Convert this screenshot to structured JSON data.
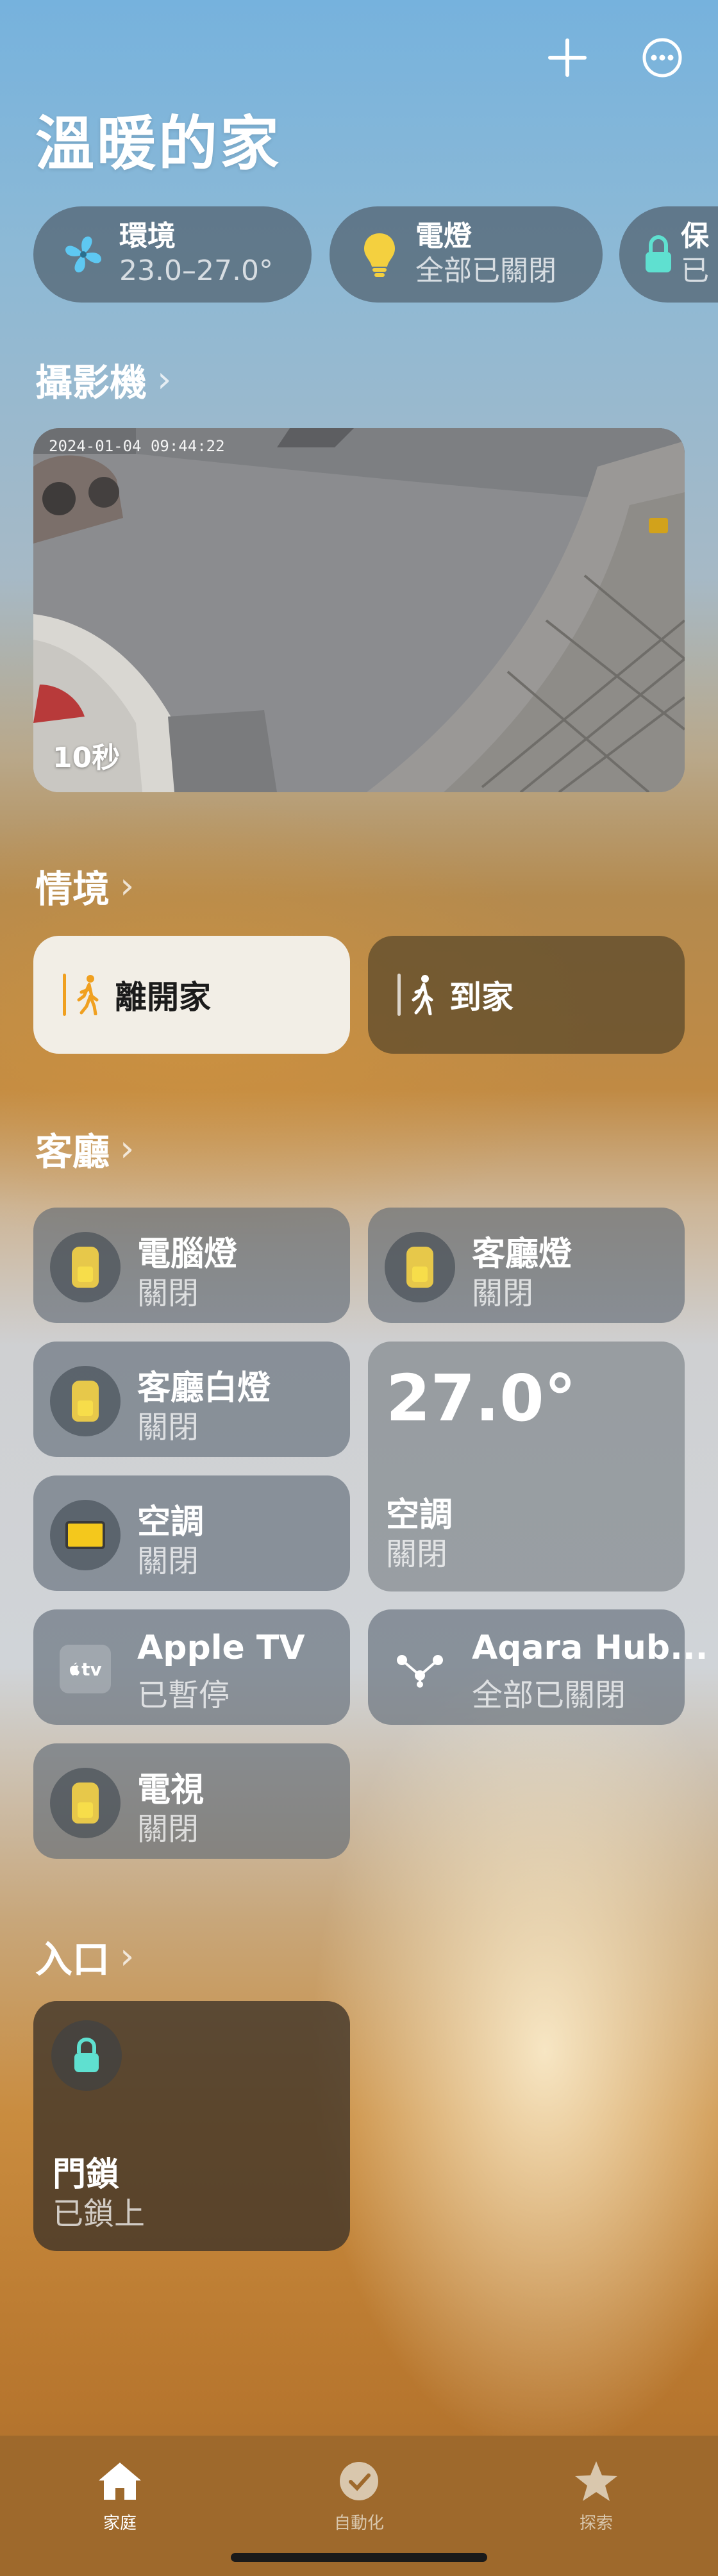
{
  "header": {
    "title": "溫暖的家",
    "add_icon": "plus-icon",
    "more_icon": "ellipsis-circle-icon"
  },
  "chips": [
    {
      "icon": "fan-icon",
      "title": "環境",
      "subtitle": "23.0–27.0°"
    },
    {
      "icon": "lightbulb-icon",
      "title": "電燈",
      "subtitle": "全部已關閉"
    },
    {
      "icon": "lock-icon",
      "title": "保",
      "subtitle": "已"
    }
  ],
  "camera_section": {
    "title": "攝影機",
    "timestamp": "2024-01-04 09:44:22",
    "duration": "10秒"
  },
  "scenes_section": {
    "title": "情境",
    "scenes": [
      {
        "icon": "walking-person-icon",
        "label": "離開家",
        "active": true
      },
      {
        "icon": "walking-person-icon",
        "label": "到家",
        "active": false
      }
    ]
  },
  "living_room": {
    "title": "客廳",
    "accessories": [
      {
        "icon": "light-switch-icon",
        "name": "電腦燈",
        "status": "關閉"
      },
      {
        "icon": "light-switch-icon",
        "name": "客廳燈",
        "status": "關閉"
      },
      {
        "icon": "light-switch-icon",
        "name": "客廳白燈",
        "status": "關閉"
      },
      {
        "icon": "air-conditioner-icon",
        "name": "空調",
        "status": "關閉"
      },
      {
        "icon": "appletv-icon",
        "name": "Apple TV",
        "status": "已暫停",
        "badge": "tv"
      },
      {
        "icon": "hub-nodes-icon",
        "name": "Aqara Hub...",
        "status": "全部已關閉"
      },
      {
        "icon": "light-switch-icon",
        "name": "電視",
        "status": "關閉"
      }
    ],
    "thermostat": {
      "temperature": "27.0°",
      "name": "空調",
      "status": "關閉"
    }
  },
  "entrance": {
    "title": "入口",
    "lock": {
      "icon": "lock-icon",
      "name": "門鎖",
      "status": "已鎖上"
    }
  },
  "tabs": [
    {
      "icon": "house-icon",
      "label": "家庭",
      "active": true
    },
    {
      "icon": "clock-check-icon",
      "label": "自動化",
      "active": false
    },
    {
      "icon": "star-icon",
      "label": "探索",
      "active": false
    }
  ],
  "colors": {
    "accent": "#f0a020",
    "lock_mint": "#5fe0d0",
    "bulb": "#f4d03f",
    "tabbar": "#9e692c"
  }
}
